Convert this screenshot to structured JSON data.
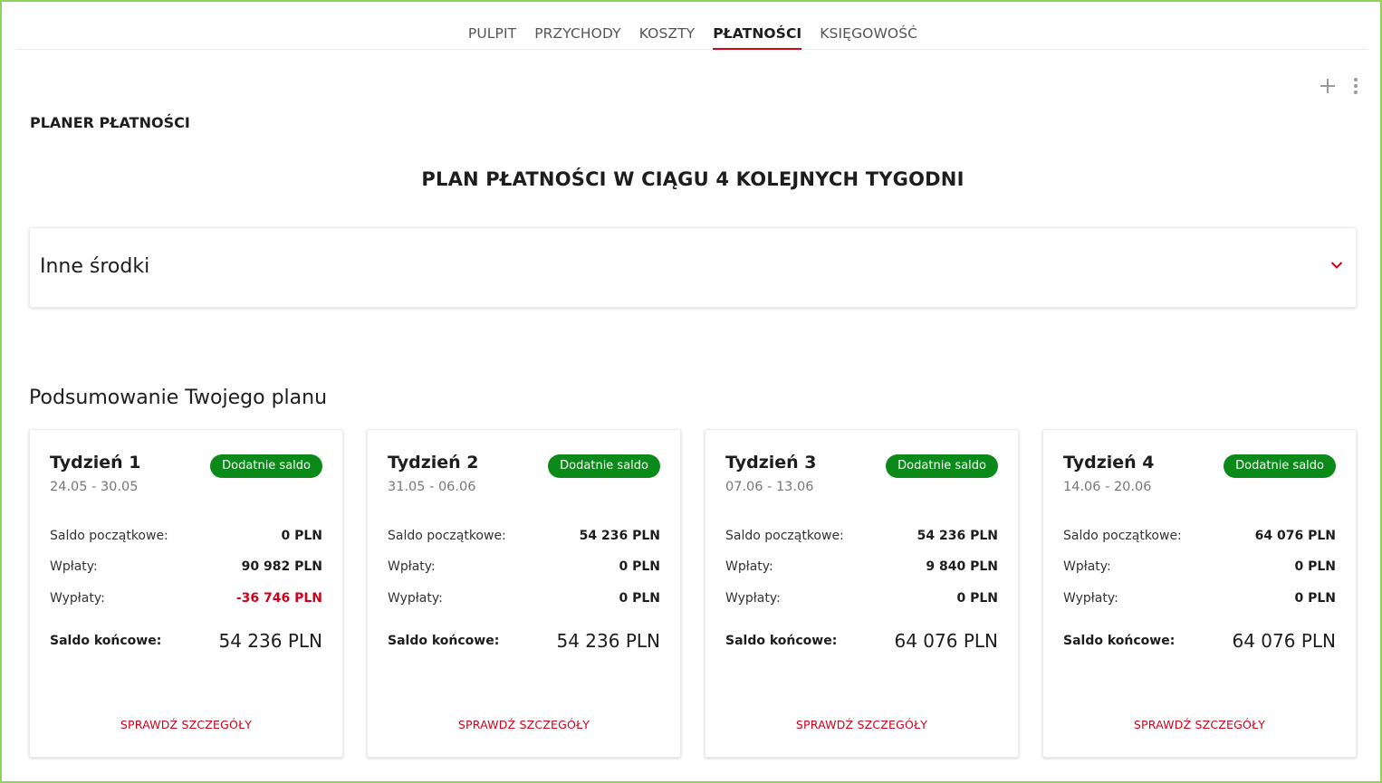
{
  "nav": {
    "tabs": [
      {
        "label": "PULPIT",
        "active": false
      },
      {
        "label": "PRZYCHODY",
        "active": false
      },
      {
        "label": "KOSZTY",
        "active": false
      },
      {
        "label": "PŁATNOŚCI",
        "active": true
      },
      {
        "label": "KSIĘGOWOŚĆ",
        "active": false
      }
    ]
  },
  "header": {
    "add_icon": "plus-icon",
    "more_icon": "more-vertical-icon"
  },
  "section_title": "PLANER PŁATNOŚCI",
  "plan_title": "PLAN PŁATNOŚCI W CIĄGU 4 KOLEJNYCH TYGODNI",
  "accordion": {
    "label": "Inne środki",
    "icon": "chevron-down-icon",
    "expanded": false
  },
  "summary": {
    "title": "Podsumowanie Twojego planu",
    "labels": {
      "opening": "Saldo początkowe:",
      "income": "Wpłaty:",
      "payments": "Wypłaty:",
      "closing": "Saldo końcowe:",
      "details": "SPRAWDŹ SZCZEGÓŁY"
    },
    "weeks": [
      {
        "title": "Tydzień 1",
        "dates": "24.05 - 30.05",
        "badge": "Dodatnie saldo",
        "opening": "0 PLN",
        "income": "90 982 PLN",
        "payments": "-36 746 PLN",
        "payments_negative": true,
        "closing": "54 236 PLN"
      },
      {
        "title": "Tydzień 2",
        "dates": "31.05 - 06.06",
        "badge": "Dodatnie saldo",
        "opening": "54 236 PLN",
        "income": "0 PLN",
        "payments": "0 PLN",
        "payments_negative": false,
        "closing": "54 236 PLN"
      },
      {
        "title": "Tydzień 3",
        "dates": "07.06 - 13.06",
        "badge": "Dodatnie saldo",
        "opening": "54 236 PLN",
        "income": "9 840 PLN",
        "payments": "0 PLN",
        "payments_negative": false,
        "closing": "64 076 PLN"
      },
      {
        "title": "Tydzień 4",
        "dates": "14.06 - 20.06",
        "badge": "Dodatnie saldo",
        "opening": "64 076 PLN",
        "income": "0 PLN",
        "payments": "0 PLN",
        "payments_negative": false,
        "closing": "64 076 PLN"
      }
    ]
  },
  "colors": {
    "accent_red": "#d0021b",
    "badge_green": "#0b8a1a",
    "frame_green": "#8fd45a"
  }
}
